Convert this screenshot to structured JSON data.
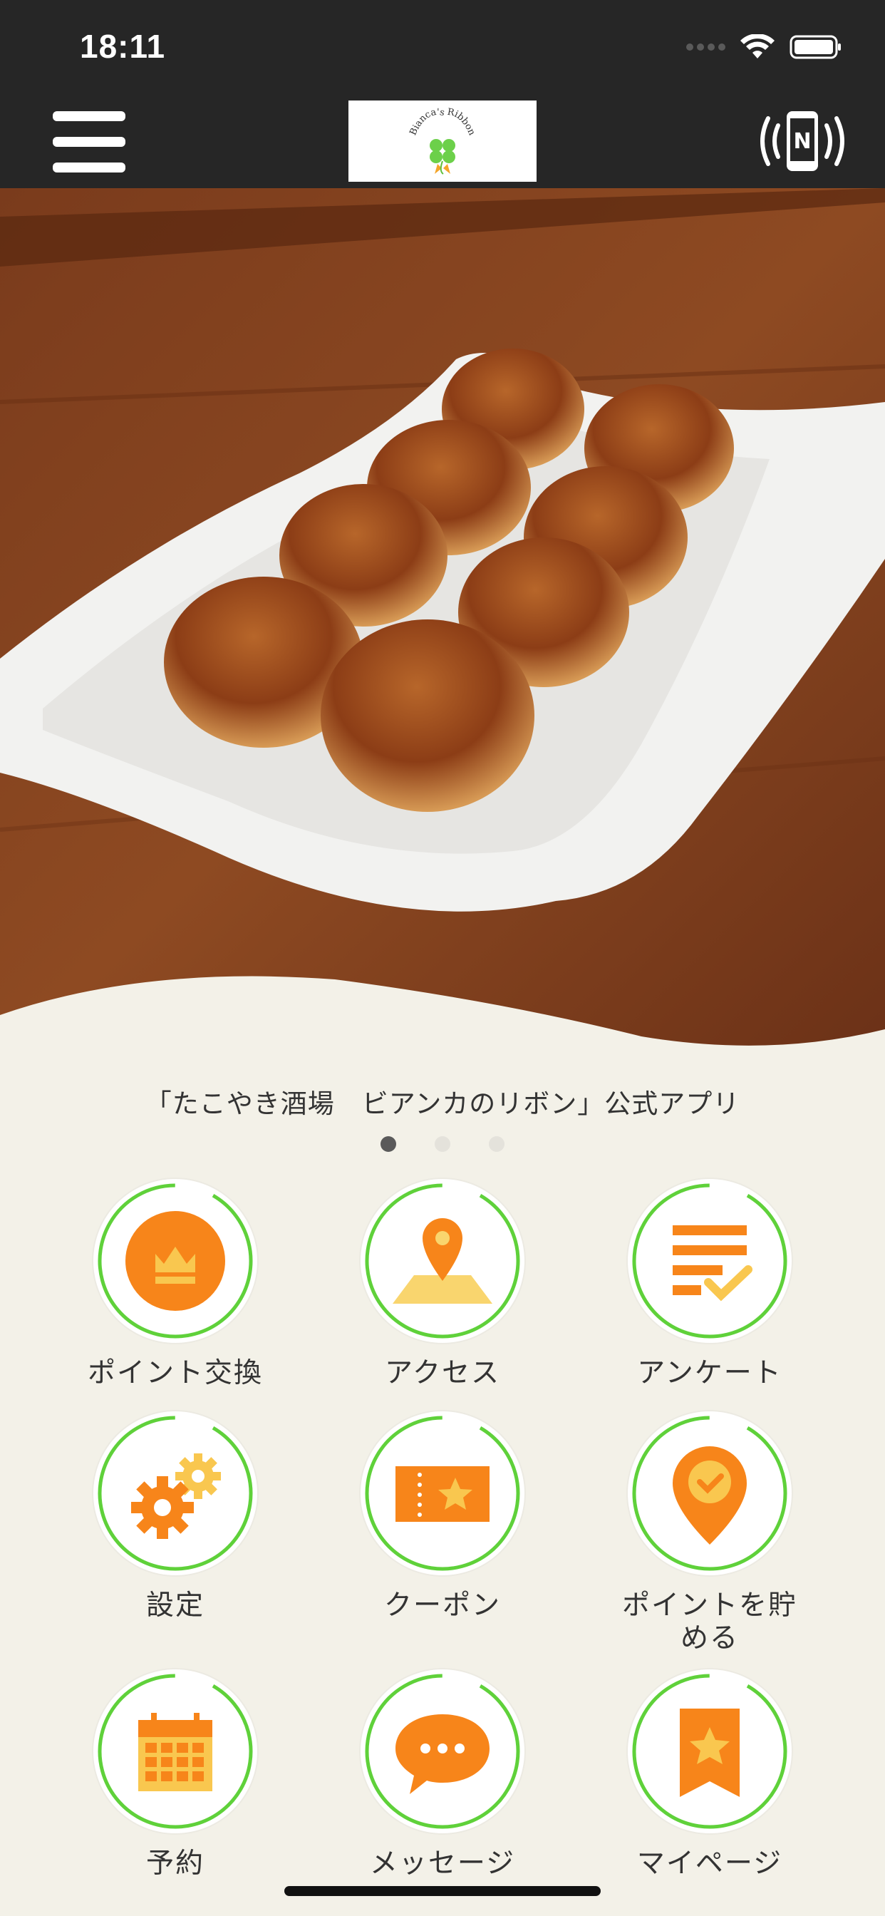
{
  "status_bar": {
    "time": "18:11"
  },
  "header": {
    "logo_text": "Bianca's Ribbon"
  },
  "hero": {
    "image_alt": "takoyaki photo"
  },
  "tagline": "「たこやき酒場　ビアンカのリボン」公式アプリ",
  "carousel": {
    "total": 3,
    "active": 1
  },
  "menu": [
    {
      "label": "ポイント交換",
      "icon": "crown-icon"
    },
    {
      "label": "アクセス",
      "icon": "map-pin-icon"
    },
    {
      "label": "アンケート",
      "icon": "survey-check-icon"
    },
    {
      "label": "設定",
      "icon": "gear-icon"
    },
    {
      "label": "クーポン",
      "icon": "coupon-ticket-icon"
    },
    {
      "label": "ポイントを貯める",
      "icon": "location-check-icon"
    },
    {
      "label": "予約",
      "icon": "calendar-icon"
    },
    {
      "label": "メッセージ",
      "icon": "chat-bubble-icon"
    },
    {
      "label": "マイページ",
      "icon": "bookmark-star-icon"
    }
  ],
  "colors": {
    "accent_orange": "#f7851a",
    "accent_yellow": "#f9c74f",
    "ring_green": "#5fd13a",
    "header_bg": "#262626"
  }
}
